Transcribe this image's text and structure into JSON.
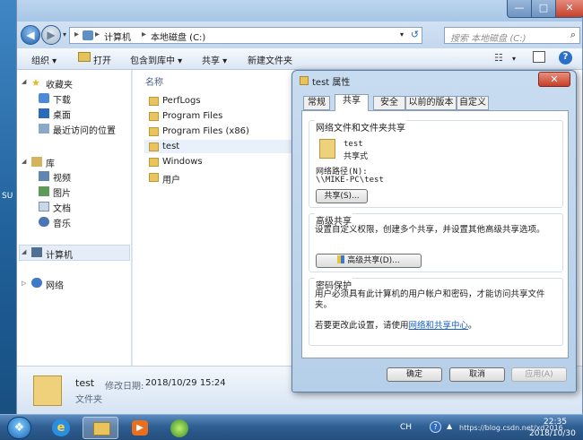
{
  "desktop": {
    "edge_text": "SU"
  },
  "window_controls": {
    "minimize": "—",
    "maximize": "□",
    "close": "✕"
  },
  "address": {
    "crumbs": [
      "计算机",
      "本地磁盘 (C:)"
    ],
    "separator": "▸",
    "dropdown": "▾",
    "refresh": "↺",
    "search_placeholder": "搜索 本地磁盘 (C:)"
  },
  "toolbar": {
    "organize": "组织 ▾",
    "open": "打开",
    "include_library": "包含到库中 ▾",
    "share": "共享 ▾",
    "new_folder": "新建文件夹",
    "help": "?"
  },
  "navpane": {
    "favorites": "收藏夹",
    "downloads": "下载",
    "desktop": "桌面",
    "recent": "最近访问的位置",
    "libraries": "库",
    "videos": "视频",
    "pictures": "图片",
    "documents": "文档",
    "music": "音乐",
    "computer": "计算机",
    "network": "网络"
  },
  "filelist": {
    "column_name": "名称",
    "items": [
      "PerfLogs",
      "Program Files",
      "Program Files (x86)",
      "test",
      "Windows",
      "用户"
    ]
  },
  "details": {
    "name": "test",
    "modified_label": "修改日期:",
    "modified_date": "2018/10/29 15:24",
    "type": "文件夹"
  },
  "dialog": {
    "title": "test 属性",
    "tabs": [
      "常规",
      "共享",
      "安全",
      "以前的版本",
      "自定义"
    ],
    "active_tab": 1,
    "group_network": {
      "title": "网络文件和文件夹共享",
      "folder_name": "test",
      "share_state": "共享式",
      "path_label": "网络路径(N):",
      "path": "\\\\MIKE-PC\\test",
      "share_button": "共享(S)..."
    },
    "group_advanced": {
      "title": "高级共享",
      "description": "设置自定义权限，创建多个共享，并设置其他高级共享选项。",
      "button": "高级共享(D)..."
    },
    "group_password": {
      "title": "密码保护",
      "description": "用户必须具有此计算机的用户帐户和密码，才能访问共享文件夹。",
      "change_prefix": "若要更改此设置，请使用",
      "change_link": "网络和共享中心",
      "change_suffix": "。"
    },
    "buttons": {
      "ok": "确定",
      "cancel": "取消",
      "apply": "应用(A)"
    }
  },
  "taskbar": {
    "language": "CH",
    "clock_time": "22:35",
    "clock_date": "2018/10/30",
    "watermark": "https://blog.csdn.net/xd2016"
  }
}
